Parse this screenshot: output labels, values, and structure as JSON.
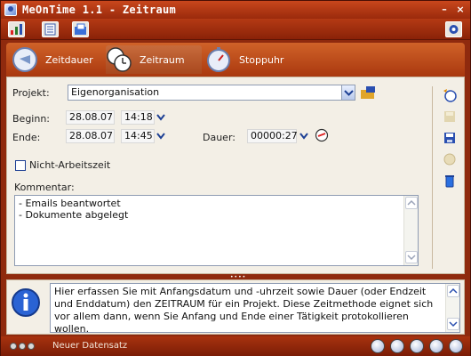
{
  "window": {
    "title": "MeOnTime 1.1 - Zeitraum"
  },
  "title_controls": {
    "minimize": "–",
    "close": "×"
  },
  "tabs": [
    {
      "label": "Zeitdauer",
      "icon": "hourglass-icon"
    },
    {
      "label": "Zeitraum",
      "icon": "clocks-icon",
      "active": true
    },
    {
      "label": "Stoppuhr",
      "icon": "stopwatch-icon"
    }
  ],
  "form": {
    "project_label": "Projekt:",
    "project_value": "Eigenorganisation",
    "begin_label": "Beginn:",
    "begin_date": "28.08.07",
    "begin_time": "14:18",
    "end_label": "Ende:",
    "end_date": "28.08.07",
    "end_time": "14:45",
    "duration_label": "Dauer:",
    "duration_value": "00000:27",
    "non_work_label": "Nicht-Arbeitszeit",
    "non_work_checked": false,
    "comment_label": "Kommentar:",
    "comment_lines": [
      "- Emails beantwortet",
      "- Dokumente abgelegt"
    ]
  },
  "info": {
    "text": "Hier erfassen Sie mit Anfangsdatum und -uhrzeit sowie Dauer (oder Endzeit und Enddatum) den ZEITRAUM für ein Projekt. Diese Zeitmethode eignet sich vor allem dann, wenn Sie Anfang und Ende einer Tätigkeit protokollieren wollen."
  },
  "status": {
    "text": "Neuer Datensatz"
  },
  "colors": {
    "accent": "#a9380f",
    "panel_bg": "#f3efe6",
    "link_blue": "#1c3f94"
  }
}
